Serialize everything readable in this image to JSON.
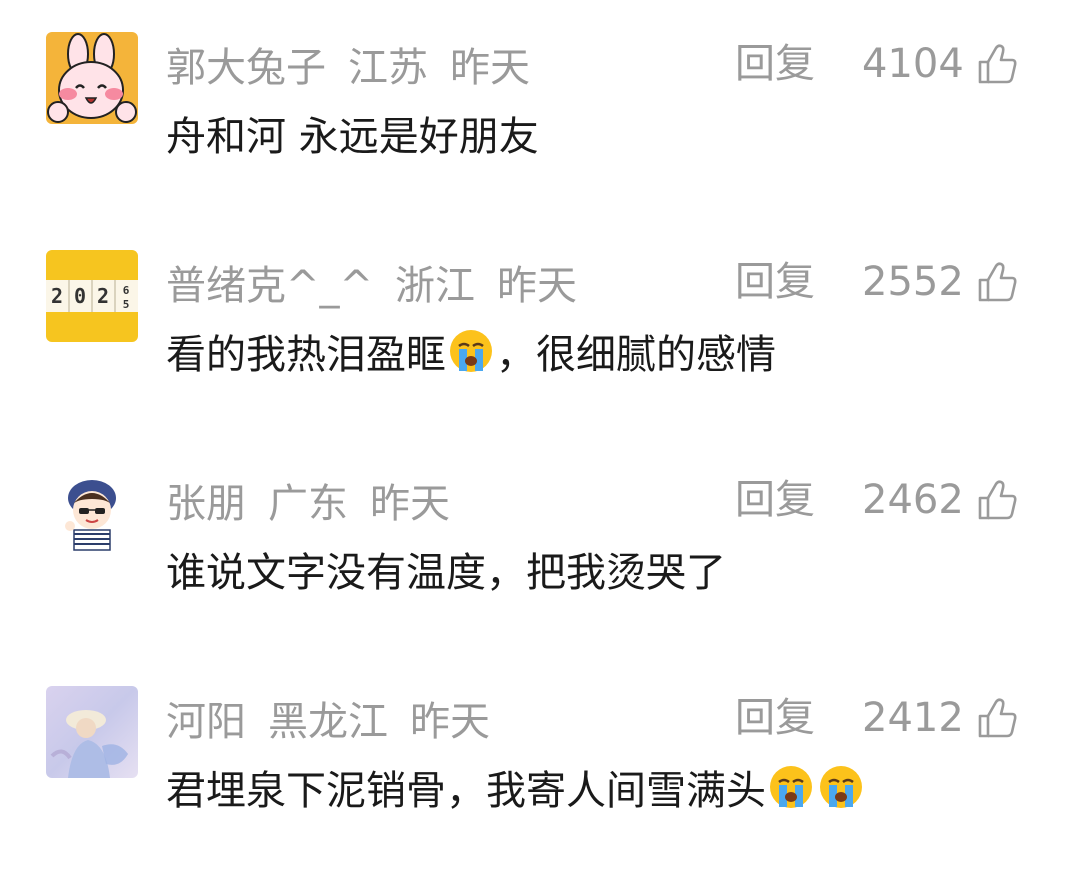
{
  "comments": [
    {
      "user": "郭大兔子",
      "location": "江苏",
      "time": "昨天",
      "reply": "回复",
      "likes": "4104",
      "text_before": "舟和河 永远是好朋友",
      "text_after": "",
      "emoji_count": 0,
      "avatar": "bunny-avatar"
    },
    {
      "user": "普绪克^_^",
      "location": "浙江",
      "time": "昨天",
      "reply": "回复",
      "likes": "2552",
      "text_before": "看的我热泪盈眶",
      "text_after": "，很细腻的感情",
      "emoji_count": 1,
      "avatar": "calendar-2025-avatar"
    },
    {
      "user": "张朋",
      "location": "广东",
      "time": "昨天",
      "reply": "回复",
      "likes": "2462",
      "text_before": "谁说文字没有温度，把我烫哭了",
      "text_after": "",
      "emoji_count": 0,
      "avatar": "cartoon-boy-avatar"
    },
    {
      "user": "河阳",
      "location": "黑龙江",
      "time": "昨天",
      "reply": "回复",
      "likes": "2412",
      "text_before": "君埋泉下泥销骨，我寄人间雪满头",
      "text_after": "",
      "emoji_count": 2,
      "avatar": "painting-avatar"
    }
  ],
  "colors": {
    "meta_text": "#9a9a9a",
    "body_text": "#1a1a1a",
    "background": "#ffffff"
  },
  "icons": {
    "like": "thumbs-up-icon",
    "emoji": "crying-face-icon"
  }
}
